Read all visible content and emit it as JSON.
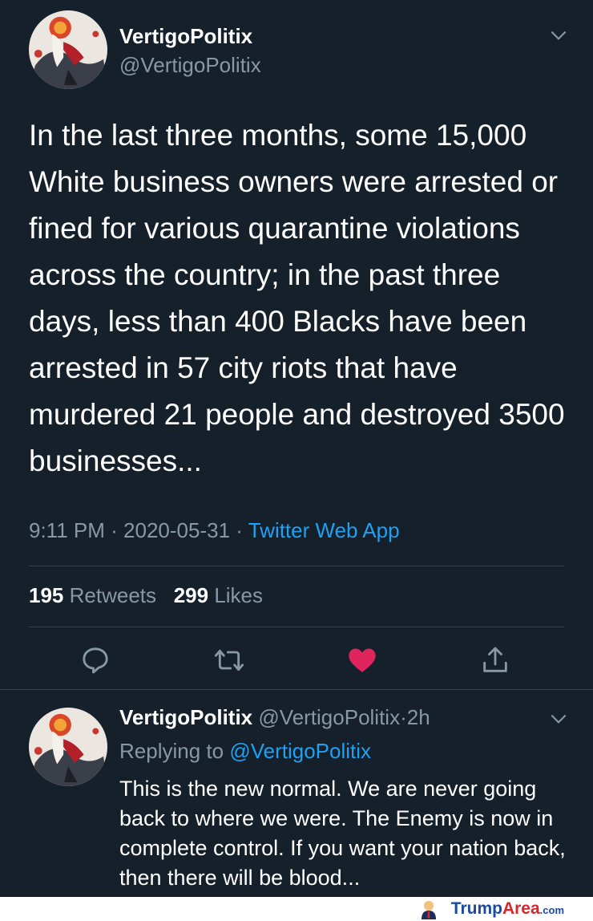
{
  "main_tweet": {
    "display_name": "VertigoPolitix",
    "handle": "@VertigoPolitix",
    "text": "In the last three months, some 15,000 White business owners were arrested or fined for various quarantine violations across the country; in the past three days, less than 400 Blacks have been arrested in 57 city riots that have murdered 21 people and destroyed 3500 businesses...",
    "time": "9:11 PM",
    "date": "2020-05-31",
    "separator": "·",
    "source": "Twitter Web App",
    "retweets_count": "195",
    "retweets_label": "Retweets",
    "likes_count": "299",
    "likes_label": "Likes",
    "liked": true
  },
  "reply_tweet": {
    "display_name": "VertigoPolitix",
    "handle": "@VertigoPolitix",
    "age": "2h",
    "replying_label": "Replying to",
    "replying_handle": "@VertigoPolitix",
    "text": "This is the new normal. We are never going back to where we were. The Enemy is now in complete control. If you want your nation back, then there will be blood..."
  },
  "footer": {
    "brand_first": "Trump",
    "brand_second": "Area",
    "brand_tld": ".com"
  },
  "icons": [
    "avatar-image",
    "chevron-down-icon",
    "reply-icon",
    "retweet-icon",
    "heart-icon",
    "share-icon",
    "trump-mascot-icon"
  ],
  "colors": {
    "background": "#15202b",
    "text_secondary": "#8899a6",
    "link": "#1da1f2",
    "like": "#e0245e",
    "divider": "#38444d"
  }
}
